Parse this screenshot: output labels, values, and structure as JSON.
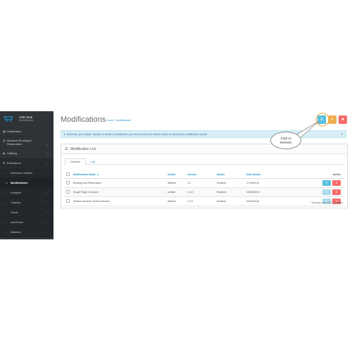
{
  "profile": {
    "name": "John Doe",
    "role": "Administrator"
  },
  "sidebar": {
    "items": [
      {
        "icon": "dashboard-icon",
        "label": "Dashboard"
      },
      {
        "icon": "calendar-icon",
        "label": "Advance Booking & Reservation"
      },
      {
        "icon": "tag-icon",
        "label": "Catalog"
      },
      {
        "icon": "puzzle-icon",
        "label": "Extensions"
      }
    ],
    "sub_items": [
      {
        "label": "Extension Installer"
      },
      {
        "label": "Modifications"
      },
      {
        "label": "Analytics"
      },
      {
        "label": "Captcha"
      },
      {
        "label": "Feeds"
      },
      {
        "label": "Anti-Fraud"
      },
      {
        "label": "Modules"
      }
    ]
  },
  "header": {
    "title": "Modifications",
    "breadcrumb": {
      "home": "Home",
      "separator": "»",
      "current": "Modifications"
    }
  },
  "alert": {
    "text": "Whenever you enable / disable or delete a modification you need to click the refresh button to rebuild your modification cache!",
    "close": "×"
  },
  "panel": {
    "title": "Modification List",
    "tabs": [
      {
        "label": "General"
      },
      {
        "label": "Log"
      }
    ],
    "columns": {
      "name": "Modification Name ▲",
      "author": "Author",
      "version": "Version",
      "status": "Status",
      "date": "Date Added",
      "action": "Action"
    },
    "rows": [
      {
        "name": "Booking and Reservation",
        "author": "Webkul",
        "version": "1.0",
        "status": "Enabled",
        "date": "17/05/2016",
        "refresh_enabled": true
      },
      {
        "name": "Single Page Checkout",
        "author": "webkul",
        "version": "1.0.0",
        "status": "Enabled",
        "date": "18/05/2016",
        "refresh_enabled": false
      },
      {
        "name": "Webkul Advance Search Module",
        "author": "Webkul",
        "version": "1.0.0",
        "status": "Enabled",
        "date": "04/05/2016",
        "refresh_enabled": false
      }
    ],
    "pager": "Showing 1 to 3 of 3 (1 Pages)"
  },
  "callout": {
    "line1": "Click to",
    "line2": "Refresh"
  },
  "colors": {
    "sidebar": "#2f3337",
    "info": "#5bc0de",
    "warning": "#f0ad4e",
    "danger": "#f56b6b",
    "link": "#1e91cf",
    "alert_bg": "#d9edf7"
  }
}
